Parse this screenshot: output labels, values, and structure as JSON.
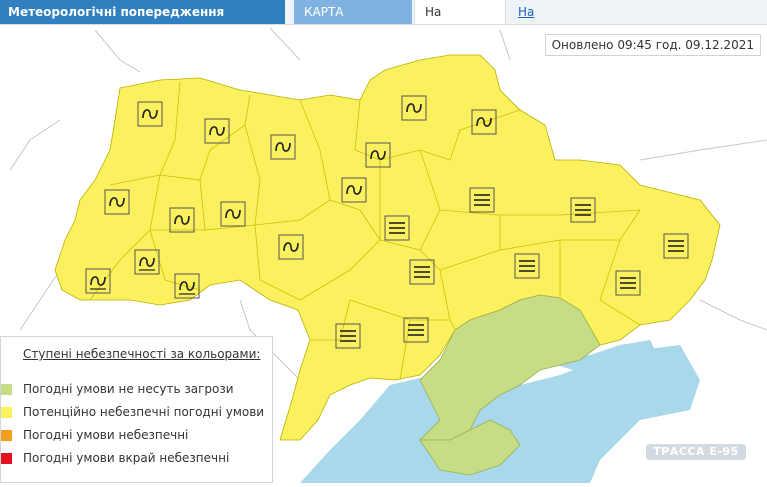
{
  "header": {
    "title": "Метеорологічні попередження",
    "tab_map": "КАРТА УКРАЇНИ",
    "tab_today": "На сьогодні",
    "tab_tomorrow": "На завтра"
  },
  "updated": "Оновлено 09:45 год. 09.12.2021",
  "legend": {
    "title": "Ступені небезпечності за кольорами:",
    "items": [
      {
        "label": "Погодні умови не несуть загрози",
        "color": "#c6dd85"
      },
      {
        "label": "Потенційно небезпечні погодні умови",
        "color": "#fbf05e"
      },
      {
        "label": "Погодні умови небезпечні",
        "color": "#f59d1c"
      },
      {
        "label": "Погодні умови вкрай небезпечні",
        "color": "#e3101d"
      }
    ]
  },
  "colors": {
    "accent": "#2f7fc1",
    "yellow_region": "#fbf05e",
    "green_region": "#c6dd85",
    "sea": "#a8d8ea",
    "border": "#c0b440"
  },
  "map_icons": [
    {
      "symbol": "ice-icon"
    },
    {
      "symbol": "ice-icon"
    },
    {
      "symbol": "ice-icon"
    },
    {
      "symbol": "ice-icon"
    },
    {
      "symbol": "ice-icon"
    },
    {
      "symbol": "ice-icon"
    },
    {
      "symbol": "ice-icon"
    },
    {
      "symbol": "ice-icon"
    },
    {
      "symbol": "ice-icon"
    },
    {
      "symbol": "ice-icon"
    },
    {
      "symbol": "ice-icon"
    },
    {
      "symbol": "ice-icon"
    },
    {
      "symbol": "ice-icon"
    },
    {
      "symbol": "ice-icon"
    },
    {
      "symbol": "ice-icon"
    },
    {
      "symbol": "fog-icon"
    },
    {
      "symbol": "fog-icon"
    },
    {
      "symbol": "fog-icon"
    },
    {
      "symbol": "fog-icon"
    },
    {
      "symbol": "fog-icon"
    },
    {
      "symbol": "fog-icon"
    },
    {
      "symbol": "fog-icon"
    },
    {
      "symbol": "fog-icon"
    },
    {
      "symbol": "fog-icon"
    }
  ],
  "watermark": "ТРАССА Е-95"
}
